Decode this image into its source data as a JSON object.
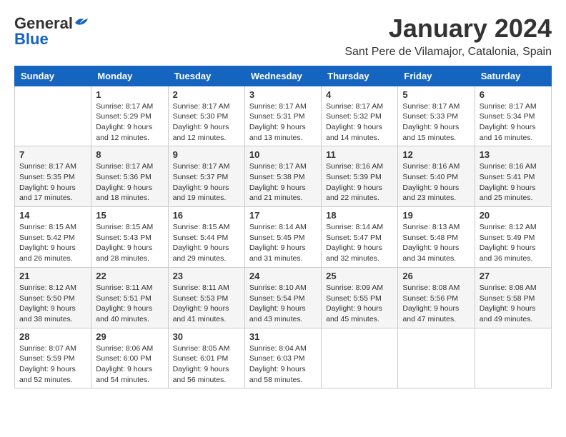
{
  "header": {
    "logo_general": "General",
    "logo_blue": "Blue",
    "month_title": "January 2024",
    "subtitle": "Sant Pere de Vilamajor, Catalonia, Spain"
  },
  "weekdays": [
    "Sunday",
    "Monday",
    "Tuesday",
    "Wednesday",
    "Thursday",
    "Friday",
    "Saturday"
  ],
  "weeks": [
    [
      {
        "day": "",
        "sunrise": "",
        "sunset": "",
        "daylight": ""
      },
      {
        "day": "1",
        "sunrise": "Sunrise: 8:17 AM",
        "sunset": "Sunset: 5:29 PM",
        "daylight": "Daylight: 9 hours and 12 minutes."
      },
      {
        "day": "2",
        "sunrise": "Sunrise: 8:17 AM",
        "sunset": "Sunset: 5:30 PM",
        "daylight": "Daylight: 9 hours and 12 minutes."
      },
      {
        "day": "3",
        "sunrise": "Sunrise: 8:17 AM",
        "sunset": "Sunset: 5:31 PM",
        "daylight": "Daylight: 9 hours and 13 minutes."
      },
      {
        "day": "4",
        "sunrise": "Sunrise: 8:17 AM",
        "sunset": "Sunset: 5:32 PM",
        "daylight": "Daylight: 9 hours and 14 minutes."
      },
      {
        "day": "5",
        "sunrise": "Sunrise: 8:17 AM",
        "sunset": "Sunset: 5:33 PM",
        "daylight": "Daylight: 9 hours and 15 minutes."
      },
      {
        "day": "6",
        "sunrise": "Sunrise: 8:17 AM",
        "sunset": "Sunset: 5:34 PM",
        "daylight": "Daylight: 9 hours and 16 minutes."
      }
    ],
    [
      {
        "day": "7",
        "sunrise": "Sunrise: 8:17 AM",
        "sunset": "Sunset: 5:35 PM",
        "daylight": "Daylight: 9 hours and 17 minutes."
      },
      {
        "day": "8",
        "sunrise": "Sunrise: 8:17 AM",
        "sunset": "Sunset: 5:36 PM",
        "daylight": "Daylight: 9 hours and 18 minutes."
      },
      {
        "day": "9",
        "sunrise": "Sunrise: 8:17 AM",
        "sunset": "Sunset: 5:37 PM",
        "daylight": "Daylight: 9 hours and 19 minutes."
      },
      {
        "day": "10",
        "sunrise": "Sunrise: 8:17 AM",
        "sunset": "Sunset: 5:38 PM",
        "daylight": "Daylight: 9 hours and 21 minutes."
      },
      {
        "day": "11",
        "sunrise": "Sunrise: 8:16 AM",
        "sunset": "Sunset: 5:39 PM",
        "daylight": "Daylight: 9 hours and 22 minutes."
      },
      {
        "day": "12",
        "sunrise": "Sunrise: 8:16 AM",
        "sunset": "Sunset: 5:40 PM",
        "daylight": "Daylight: 9 hours and 23 minutes."
      },
      {
        "day": "13",
        "sunrise": "Sunrise: 8:16 AM",
        "sunset": "Sunset: 5:41 PM",
        "daylight": "Daylight: 9 hours and 25 minutes."
      }
    ],
    [
      {
        "day": "14",
        "sunrise": "Sunrise: 8:15 AM",
        "sunset": "Sunset: 5:42 PM",
        "daylight": "Daylight: 9 hours and 26 minutes."
      },
      {
        "day": "15",
        "sunrise": "Sunrise: 8:15 AM",
        "sunset": "Sunset: 5:43 PM",
        "daylight": "Daylight: 9 hours and 28 minutes."
      },
      {
        "day": "16",
        "sunrise": "Sunrise: 8:15 AM",
        "sunset": "Sunset: 5:44 PM",
        "daylight": "Daylight: 9 hours and 29 minutes."
      },
      {
        "day": "17",
        "sunrise": "Sunrise: 8:14 AM",
        "sunset": "Sunset: 5:45 PM",
        "daylight": "Daylight: 9 hours and 31 minutes."
      },
      {
        "day": "18",
        "sunrise": "Sunrise: 8:14 AM",
        "sunset": "Sunset: 5:47 PM",
        "daylight": "Daylight: 9 hours and 32 minutes."
      },
      {
        "day": "19",
        "sunrise": "Sunrise: 8:13 AM",
        "sunset": "Sunset: 5:48 PM",
        "daylight": "Daylight: 9 hours and 34 minutes."
      },
      {
        "day": "20",
        "sunrise": "Sunrise: 8:12 AM",
        "sunset": "Sunset: 5:49 PM",
        "daylight": "Daylight: 9 hours and 36 minutes."
      }
    ],
    [
      {
        "day": "21",
        "sunrise": "Sunrise: 8:12 AM",
        "sunset": "Sunset: 5:50 PM",
        "daylight": "Daylight: 9 hours and 38 minutes."
      },
      {
        "day": "22",
        "sunrise": "Sunrise: 8:11 AM",
        "sunset": "Sunset: 5:51 PM",
        "daylight": "Daylight: 9 hours and 40 minutes."
      },
      {
        "day": "23",
        "sunrise": "Sunrise: 8:11 AM",
        "sunset": "Sunset: 5:53 PM",
        "daylight": "Daylight: 9 hours and 41 minutes."
      },
      {
        "day": "24",
        "sunrise": "Sunrise: 8:10 AM",
        "sunset": "Sunset: 5:54 PM",
        "daylight": "Daylight: 9 hours and 43 minutes."
      },
      {
        "day": "25",
        "sunrise": "Sunrise: 8:09 AM",
        "sunset": "Sunset: 5:55 PM",
        "daylight": "Daylight: 9 hours and 45 minutes."
      },
      {
        "day": "26",
        "sunrise": "Sunrise: 8:08 AM",
        "sunset": "Sunset: 5:56 PM",
        "daylight": "Daylight: 9 hours and 47 minutes."
      },
      {
        "day": "27",
        "sunrise": "Sunrise: 8:08 AM",
        "sunset": "Sunset: 5:58 PM",
        "daylight": "Daylight: 9 hours and 49 minutes."
      }
    ],
    [
      {
        "day": "28",
        "sunrise": "Sunrise: 8:07 AM",
        "sunset": "Sunset: 5:59 PM",
        "daylight": "Daylight: 9 hours and 52 minutes."
      },
      {
        "day": "29",
        "sunrise": "Sunrise: 8:06 AM",
        "sunset": "Sunset: 6:00 PM",
        "daylight": "Daylight: 9 hours and 54 minutes."
      },
      {
        "day": "30",
        "sunrise": "Sunrise: 8:05 AM",
        "sunset": "Sunset: 6:01 PM",
        "daylight": "Daylight: 9 hours and 56 minutes."
      },
      {
        "day": "31",
        "sunrise": "Sunrise: 8:04 AM",
        "sunset": "Sunset: 6:03 PM",
        "daylight": "Daylight: 9 hours and 58 minutes."
      },
      {
        "day": "",
        "sunrise": "",
        "sunset": "",
        "daylight": ""
      },
      {
        "day": "",
        "sunrise": "",
        "sunset": "",
        "daylight": ""
      },
      {
        "day": "",
        "sunrise": "",
        "sunset": "",
        "daylight": ""
      }
    ]
  ]
}
